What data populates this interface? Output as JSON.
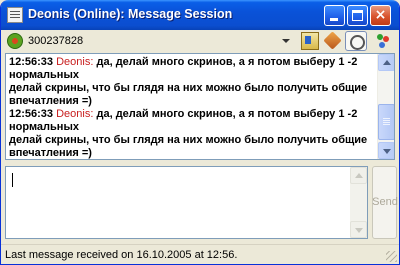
{
  "window": {
    "title": "Deonis (Online): Message Session",
    "close_glyph": "×"
  },
  "toolbar": {
    "uin": "300237828",
    "icons": [
      "status-flower-icon",
      "dropdown-arrow-icon",
      "user-info-icon",
      "send-file-icon",
      "history-clock-icon",
      "contact-menu-icon"
    ]
  },
  "history": {
    "messages": [
      {
        "time": "12:56:33",
        "author": "Deonis",
        "separator": ":",
        "text_line1": " да, делай много скринов, а я потом выберу ",
        "text_bold": "1",
        "text_line1_end": " -2 нормальных",
        "text_line2": "делай скрины, что бы глядя на них можно было получить общие",
        "text_line3": "впечатления =)"
      },
      {
        "time": "12:56:33",
        "author": "Deonis",
        "separator": ":",
        "text_line1": " да, делай много скринов, а я потом выберу ",
        "text_bold": "1",
        "text_line1_end": " -2 нормальных",
        "text_line2": "делай скрины, что бы глядя на них можно было получить общие",
        "text_line3": "впечатления =)"
      }
    ]
  },
  "input": {
    "value": ""
  },
  "send_button": {
    "label": "Send"
  },
  "status": {
    "text": "Last message received on 16.10.2005 at 12:56."
  },
  "colors": {
    "author": "#c81e1e",
    "titlebar": "#0a52d8"
  }
}
